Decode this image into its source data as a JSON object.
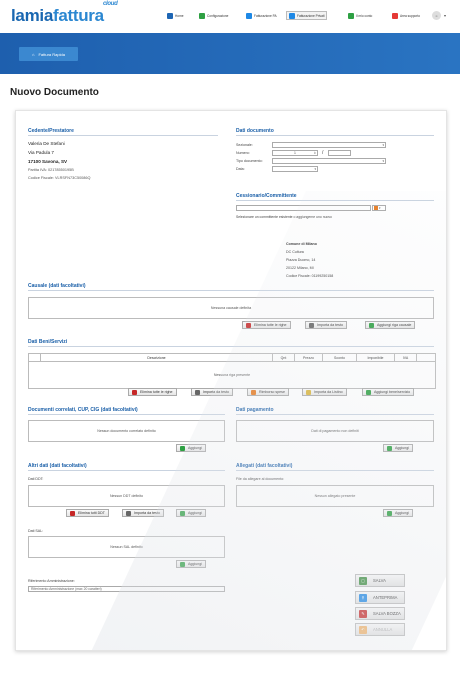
{
  "logo": {
    "main": "lamiafattura",
    "part1": "lamia",
    "part2": "fattura",
    "cloud": "cloud"
  },
  "nav": [
    {
      "label": "Home",
      "icon": "home-icon",
      "color": "#1e66b4"
    },
    {
      "label": "Configurazione",
      "icon": "config-icon",
      "color": "#2ea043"
    },
    {
      "label": "Fatturazione PA",
      "icon": "invoice-pa-icon",
      "color": "#1e88e5"
    },
    {
      "label": "Fatturazione Privati",
      "icon": "invoice-private-icon",
      "color": "#1e88e5"
    },
    {
      "label": "Il mio conto",
      "icon": "account-icon",
      "color": "#2ea043"
    },
    {
      "label": "Area supporto",
      "icon": "support-icon",
      "color": "#e53935"
    }
  ],
  "user": {
    "avatar": "☺"
  },
  "quick": {
    "label": "Fattura Rapida",
    "icon": "home-icon"
  },
  "title": "Nuovo Documento",
  "cedente": {
    "header": "Cedente/Prestatore",
    "name": "Valeria De Stefani",
    "street": "Via Padula 7",
    "city": "17100 Savona, SV",
    "piva": "Partita IVA: 02178550195B",
    "cf": "Codice Fiscale: VLRSFN73C50086Q"
  },
  "documento": {
    "header": "Dati documento",
    "sezionale_label": "Sezionale:",
    "numero_label": "Numero:",
    "numero_value": "1",
    "slash": "/",
    "tipo_label": "Tipo documento:",
    "data_label": "Data:"
  },
  "cessionario": {
    "header": "Cessionario/Committente",
    "hint": "Selezionare un committente esistente o aggiungerne uno nuovo",
    "name": "Comune di Milano",
    "dept": "DC Cultura",
    "street": "Piazza Duomo, 14",
    "city": "20122 Milano, MI",
    "cf": "Codice Fiscale: 01199250158"
  },
  "causale": {
    "header": "Causale (dati facoltativi)",
    "empty": "Nessuna causale definita",
    "btn_delete": "Elimina tutte le righe",
    "btn_import": "Importa da testo",
    "btn_add": "Aggiungi riga causale"
  },
  "beni": {
    "header": "Dati Beni/Servizi",
    "columns": [
      "",
      "Descrizione",
      "Qnt",
      "Prezzo",
      "Sconto",
      "Imponibile",
      "IVA",
      ""
    ],
    "empty": "Nessuna riga presente",
    "btn_delete": "Elimina tutte le righe",
    "btn_import": "Importa da testo",
    "btn_rimborso": "Rimborso spese",
    "btn_listino": "Importa da Listino",
    "btn_add": "Aggiungi bene/servizio"
  },
  "correlati": {
    "header": "Documenti correlati, CUP, CIG (dati facoltativi)",
    "empty": "Nessun documento correlato definito",
    "btn_add": "Aggiungi"
  },
  "pagamento": {
    "header": "Dati pagamento",
    "empty": "Dati di pagamento non definiti",
    "btn_add": "Aggiungi"
  },
  "altri": {
    "header": "Altri dati (dati facoltativi)",
    "ddt_label": "Dati DDT:",
    "ddt_empty": "Nessun DDT definito",
    "btn_delete": "Elimina tutti DDT",
    "btn_import": "Importa da testo",
    "btn_add": "Aggiungi",
    "sal_label": "Dati SAL:",
    "sal_empty": "Nessun SAL definito",
    "sal_btn_add": "Aggiungi",
    "rif_label": "Riferimento Amministrazione:",
    "rif_placeholder": "Riferimento Amministrazione (max 20 caratteri)"
  },
  "allegati": {
    "header": "Allegati (dati facoltativi)",
    "label": "File da allegare al documento:",
    "empty": "Nessun allegato presente",
    "btn_add": "Aggiungi"
  },
  "actions": {
    "save": "SALVA",
    "preview": "ANTEPRIMA",
    "draft": "SALVA BOZZA",
    "cancel": "ANNULLA"
  },
  "colors": {
    "brand": "#1e66b4",
    "section": "#1a5fa8",
    "green": "#2ea043",
    "red": "#c62828"
  }
}
